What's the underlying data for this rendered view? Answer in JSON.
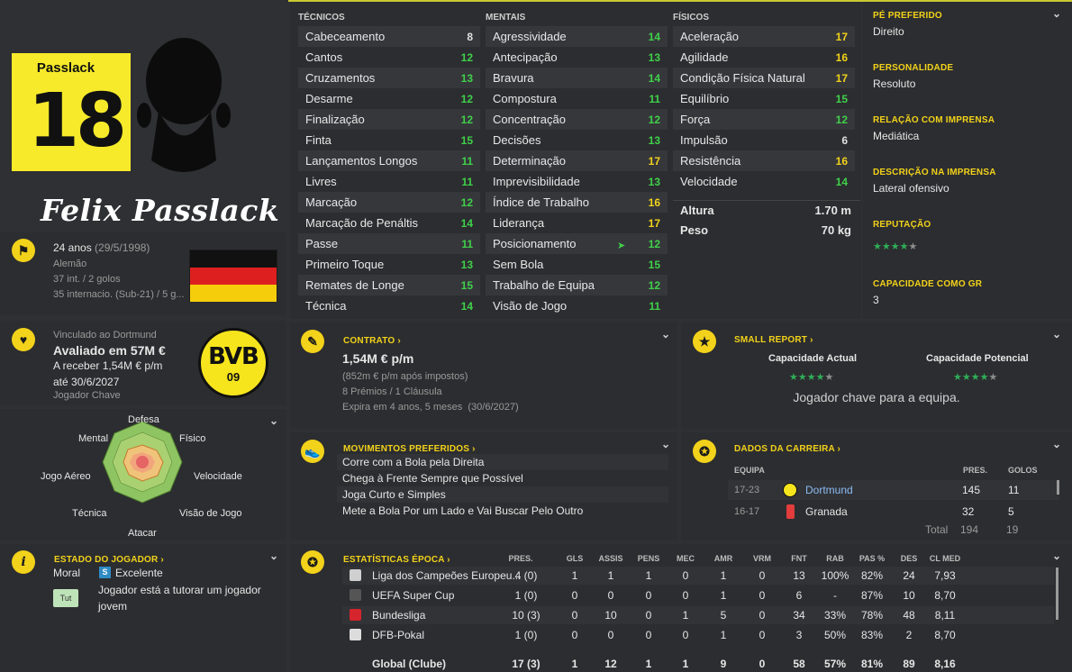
{
  "player": {
    "shirt_name": "Passlack",
    "shirt_number": "18",
    "name": "Felix Passlack",
    "age": "24 anos",
    "dob": "(29/5/1998)",
    "nationality": "Alemão",
    "caps": "37 int. / 2 golos",
    "youth_caps": "35 internacio. (Sub-21) / 5 g..."
  },
  "club": {
    "contract_with": "Vinculado ao Dortmund",
    "value": "Avaliado em 57M €",
    "wage_line1": "A receber 1,54M € p/m",
    "wage_line2": "até 30/6/2027",
    "role": "Jogador Chave",
    "crest_text": "BVB",
    "crest_year": "09"
  },
  "attributes": {
    "technical_header": "TÉCNICOS",
    "mental_header": "MENTAIS",
    "physical_header": "FÍSICOS",
    "technical": [
      {
        "name": "Cabeceamento",
        "value": "8",
        "color": "w"
      },
      {
        "name": "Cantos",
        "value": "12",
        "color": "g"
      },
      {
        "name": "Cruzamentos",
        "value": "13",
        "color": "g"
      },
      {
        "name": "Desarme",
        "value": "12",
        "color": "g"
      },
      {
        "name": "Finalização",
        "value": "12",
        "color": "g"
      },
      {
        "name": "Finta",
        "value": "15",
        "color": "g"
      },
      {
        "name": "Lançamentos Longos",
        "value": "11",
        "color": "g"
      },
      {
        "name": "Livres",
        "value": "11",
        "color": "g"
      },
      {
        "name": "Marcação",
        "value": "12",
        "color": "g"
      },
      {
        "name": "Marcação de Penáltis",
        "value": "14",
        "color": "g"
      },
      {
        "name": "Passe",
        "value": "11",
        "color": "g"
      },
      {
        "name": "Primeiro Toque",
        "value": "13",
        "color": "g"
      },
      {
        "name": "Remates de Longe",
        "value": "15",
        "color": "g"
      },
      {
        "name": "Técnica",
        "value": "14",
        "color": "g"
      }
    ],
    "mental": [
      {
        "name": "Agressividade",
        "value": "14",
        "color": "g"
      },
      {
        "name": "Antecipação",
        "value": "13",
        "color": "g"
      },
      {
        "name": "Bravura",
        "value": "14",
        "color": "g"
      },
      {
        "name": "Compostura",
        "value": "11",
        "color": "g"
      },
      {
        "name": "Concentração",
        "value": "12",
        "color": "g"
      },
      {
        "name": "Decisões",
        "value": "13",
        "color": "g"
      },
      {
        "name": "Determinação",
        "value": "17",
        "color": "y"
      },
      {
        "name": "Imprevisibilidade",
        "value": "13",
        "color": "g"
      },
      {
        "name": "Índice de Trabalho",
        "value": "16",
        "color": "y"
      },
      {
        "name": "Liderança",
        "value": "17",
        "color": "y"
      },
      {
        "name": "Posicionamento",
        "value": "12",
        "color": "g"
      },
      {
        "name": "Sem Bola",
        "value": "15",
        "color": "g"
      },
      {
        "name": "Trabalho de Equipa",
        "value": "12",
        "color": "g"
      },
      {
        "name": "Visão de Jogo",
        "value": "11",
        "color": "g"
      }
    ],
    "physical": [
      {
        "name": "Aceleração",
        "value": "17",
        "color": "y"
      },
      {
        "name": "Agilidade",
        "value": "16",
        "color": "y"
      },
      {
        "name": "Condição Física Natural",
        "value": "17",
        "color": "y"
      },
      {
        "name": "Equilíbrio",
        "value": "15",
        "color": "g"
      },
      {
        "name": "Força",
        "value": "12",
        "color": "g"
      },
      {
        "name": "Impulsão",
        "value": "6",
        "color": "w"
      },
      {
        "name": "Resistência",
        "value": "16",
        "color": "y"
      },
      {
        "name": "Velocidade",
        "value": "14",
        "color": "g"
      }
    ],
    "height_label": "Altura",
    "height": "1.70 m",
    "weight_label": "Peso",
    "weight": "70 kg"
  },
  "info": {
    "foot_label": "PÉ PREFERIDO",
    "foot": "Direito",
    "personality_label": "PERSONALIDADE",
    "personality": "Resoluto",
    "media_label": "RELAÇÃO COM IMPRENSA",
    "media": "Mediática",
    "press_label": "DESCRIÇÃO NA IMPRENSA",
    "press": "Lateral ofensivo",
    "reputation_label": "REPUTAÇÃO",
    "reputation_stars": 4,
    "gk_label": "CAPACIDADE COMO GR",
    "gk": "3"
  },
  "radar": {
    "labels": [
      "Defesa",
      "Físico",
      "Velocidade",
      "Visão de Jogo",
      "Atacar",
      "Técnica",
      "Jogo Aéreo",
      "Mental"
    ]
  },
  "status": {
    "title": "ESTADO DO JOGADOR",
    "morale_label": "Moral",
    "morale_icon": "S",
    "morale": "Excelente",
    "tag": "Tut",
    "note": "Jogador está a tutorar um jogador jovem"
  },
  "contract": {
    "title": "CONTRATO",
    "wage": "1,54M € p/m",
    "after_tax": "(852m € p/m após impostos)",
    "bonuses": "8 Prémios / 1 Cláusula",
    "expires": "Expira em 4 anos, 5 meses  (30/6/2027)"
  },
  "report": {
    "title": "SMALL REPORT",
    "current_label": "Capacidade Actual",
    "potential_label": "Capacidade Potencial",
    "current_stars": 4,
    "potential_stars": 4,
    "summary": "Jogador chave para a equipa."
  },
  "moves": {
    "title": "MOVIMENTOS PREFERIDOS",
    "items": [
      "Corre com a Bola pela Direita",
      "Chega à Frente Sempre que Possível",
      "Joga Curto e Simples",
      "Mete a Bola Por um Lado e Vai Buscar Pelo Outro"
    ]
  },
  "career": {
    "title": "DADOS DA CARREIRA",
    "col_team": "EQUIPA",
    "col_apps": "PRES.",
    "col_goals": "GOLOS",
    "rows": [
      {
        "season": "17-23",
        "team": "Dortmund",
        "apps": "145",
        "goals": "11"
      },
      {
        "season": "16-17",
        "team": "Granada",
        "apps": "32",
        "goals": "5"
      }
    ],
    "total_label": "Total",
    "total_apps": "194",
    "total_goals": "19"
  },
  "season": {
    "title": "ESTATÍSTICAS ÉPOCA",
    "headers": [
      "PRES.",
      "GLS",
      "ASSIS",
      "PENS",
      "MEC",
      "AMR",
      "VRM",
      "FNT",
      "RAB",
      "PAS %",
      "DES",
      "CL MED"
    ],
    "rows": [
      {
        "comp": "Liga dos Campeões Europeu...",
        "vals": [
          "4 (0)",
          "1",
          "1",
          "1",
          "0",
          "1",
          "0",
          "13",
          "100%",
          "82%",
          "24",
          "7,93"
        ]
      },
      {
        "comp": "UEFA Super Cup",
        "vals": [
          "1 (0)",
          "0",
          "0",
          "0",
          "0",
          "1",
          "0",
          "6",
          "-",
          "87%",
          "10",
          "8,70"
        ]
      },
      {
        "comp": "Bundesliga",
        "vals": [
          "10 (3)",
          "0",
          "10",
          "0",
          "1",
          "5",
          "0",
          "34",
          "33%",
          "78%",
          "48",
          "8,11"
        ]
      },
      {
        "comp": "DFB-Pokal",
        "vals": [
          "1 (0)",
          "0",
          "0",
          "0",
          "0",
          "1",
          "0",
          "3",
          "50%",
          "83%",
          "2",
          "8,70"
        ]
      }
    ],
    "total_label": "Global (Clube)",
    "total": [
      "17 (3)",
      "1",
      "12",
      "1",
      "1",
      "9",
      "0",
      "58",
      "57%",
      "81%",
      "89",
      "8,16"
    ]
  }
}
